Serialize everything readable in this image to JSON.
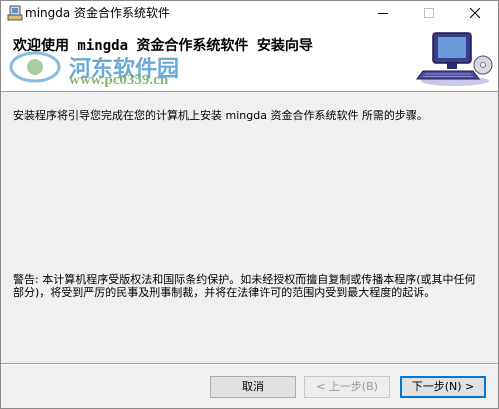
{
  "window": {
    "title": "mingda 资金合作系统软件"
  },
  "header": {
    "title": "欢迎使用 mingda 资金合作系统软件 安装向导",
    "watermark_text": "河东软件园",
    "watermark_url": "www.pc0359.cn"
  },
  "body": {
    "intro": "安装程序将引导您完成在您的计算机上安装 mingda 资金合作系统软件 所需的步骤。",
    "warning": "警告: 本计算机程序受版权法和国际条约保护。如未经授权而擅自复制或传播本程序(或其中任何部分)，将受到严厉的民事及刑事制裁，并将在法律许可的范围内受到最大程度的起诉。"
  },
  "buttons": {
    "cancel": "取消",
    "back": "< 上一步(B)",
    "next": "下一步(N) >"
  }
}
